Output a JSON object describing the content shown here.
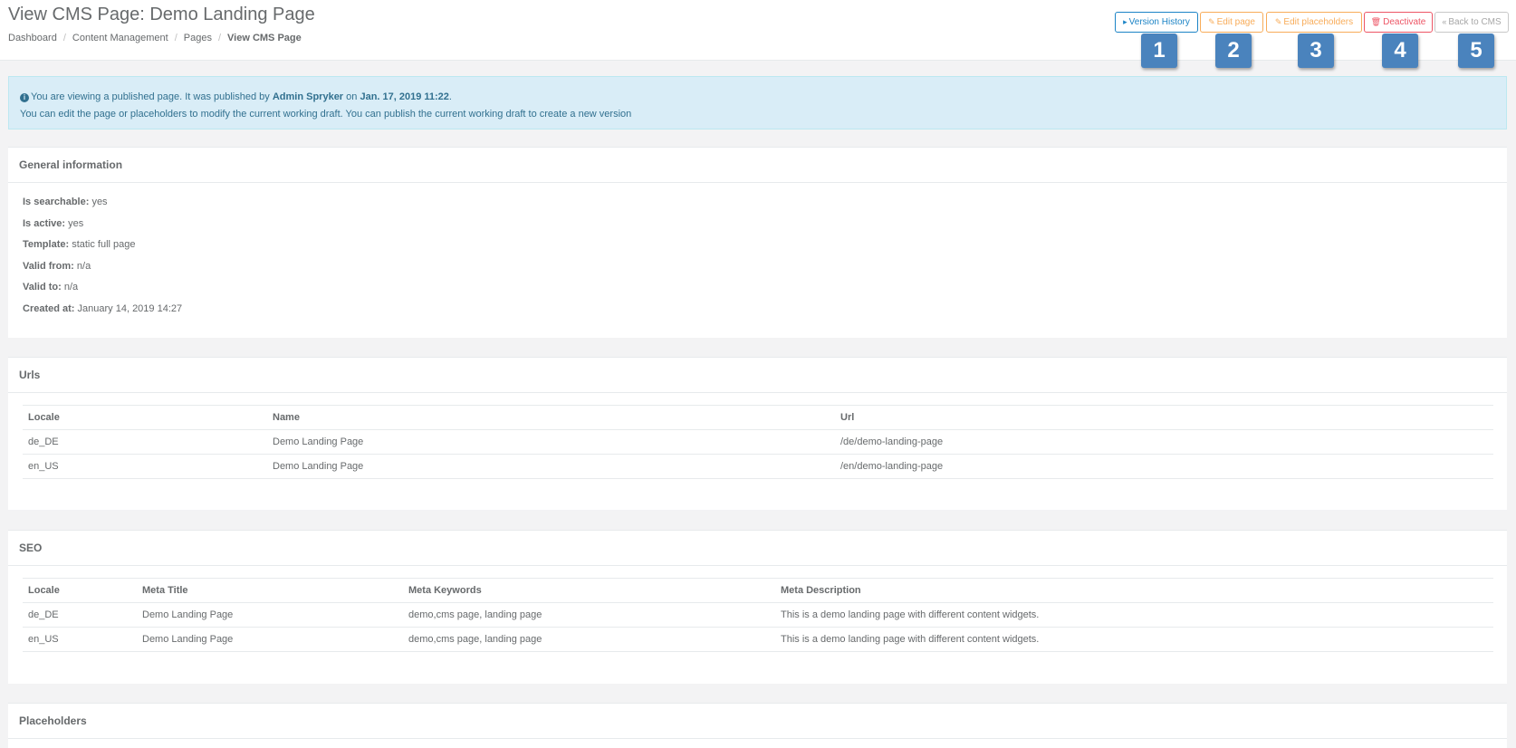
{
  "header": {
    "title": "View CMS Page: Demo Landing Page",
    "breadcrumb": [
      "Dashboard",
      "Content Management",
      "Pages",
      "View CMS Page"
    ]
  },
  "actions": {
    "version_history": "Version History",
    "edit_page": "Edit page",
    "edit_placeholders": "Edit placeholders",
    "deactivate": "Deactivate",
    "back_to_cms": "Back to CMS"
  },
  "markers": [
    "1",
    "2",
    "3",
    "4",
    "5"
  ],
  "alert": {
    "line1_prefix": "You are viewing a published page. It was published by ",
    "publisher": "Admin Spryker",
    "line1_mid": " on ",
    "published_date": "Jan. 17, 2019 11:22",
    "line1_suffix": ".",
    "line2": "You can edit the page or placeholders to modify the current working draft. You can publish the current working draft to create a new version"
  },
  "general": {
    "title": "General information",
    "fields": [
      {
        "label": "Is searchable:",
        "value": "yes"
      },
      {
        "label": "Is active:",
        "value": "yes"
      },
      {
        "label": "Template:",
        "value": "static full page"
      },
      {
        "label": "Valid from:",
        "value": "n/a"
      },
      {
        "label": "Valid to:",
        "value": "n/a"
      },
      {
        "label": "Created at:",
        "value": "January 14, 2019 14:27"
      }
    ]
  },
  "urls": {
    "title": "Urls",
    "columns": [
      "Locale",
      "Name",
      "Url"
    ],
    "rows": [
      [
        "de_DE",
        "Demo Landing Page",
        "/de/demo-landing-page"
      ],
      [
        "en_US",
        "Demo Landing Page",
        "/en/demo-landing-page"
      ]
    ]
  },
  "seo": {
    "title": "SEO",
    "columns": [
      "Locale",
      "Meta Title",
      "Meta Keywords",
      "Meta Description"
    ],
    "rows": [
      [
        "de_DE",
        "Demo Landing Page",
        "demo,cms page, landing page",
        "This is a demo landing page with different content widgets."
      ],
      [
        "en_US",
        "Demo Landing Page",
        "demo,cms page, landing page",
        "This is a demo landing page with different content widgets."
      ]
    ]
  },
  "placeholders": {
    "title": "Placeholders"
  }
}
